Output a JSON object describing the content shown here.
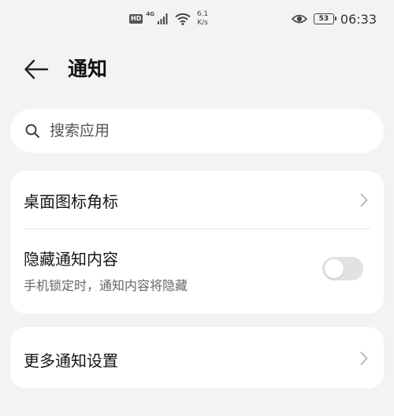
{
  "status_bar": {
    "hd_label": "HD",
    "network_type": "4G",
    "net_speed_value": "6.1",
    "net_speed_unit": "K/s",
    "battery_level": "53",
    "time": "06:33",
    "icons": [
      "signal-icon",
      "wifi-icon",
      "eye-icon",
      "battery-icon"
    ]
  },
  "header": {
    "title": "通知",
    "back_icon": "arrow-left-icon"
  },
  "search": {
    "placeholder": "搜索应用",
    "value": "",
    "icon": "search-icon"
  },
  "settings_group_1": {
    "items": [
      {
        "label": "桌面图标角标",
        "type": "link",
        "icon": "chevron-right-icon"
      },
      {
        "label": "隐藏通知内容",
        "subtitle": "手机锁定时，通知内容将隐藏",
        "type": "toggle",
        "enabled": false
      }
    ]
  },
  "settings_group_2": {
    "items": [
      {
        "label": "更多通知设置",
        "type": "link",
        "icon": "chevron-right-icon"
      }
    ]
  },
  "colors": {
    "background": "#f1f3f5",
    "card": "#ffffff",
    "toggle_off": "#e2e2e2",
    "text_primary": "#151515",
    "text_secondary": "#666666"
  }
}
